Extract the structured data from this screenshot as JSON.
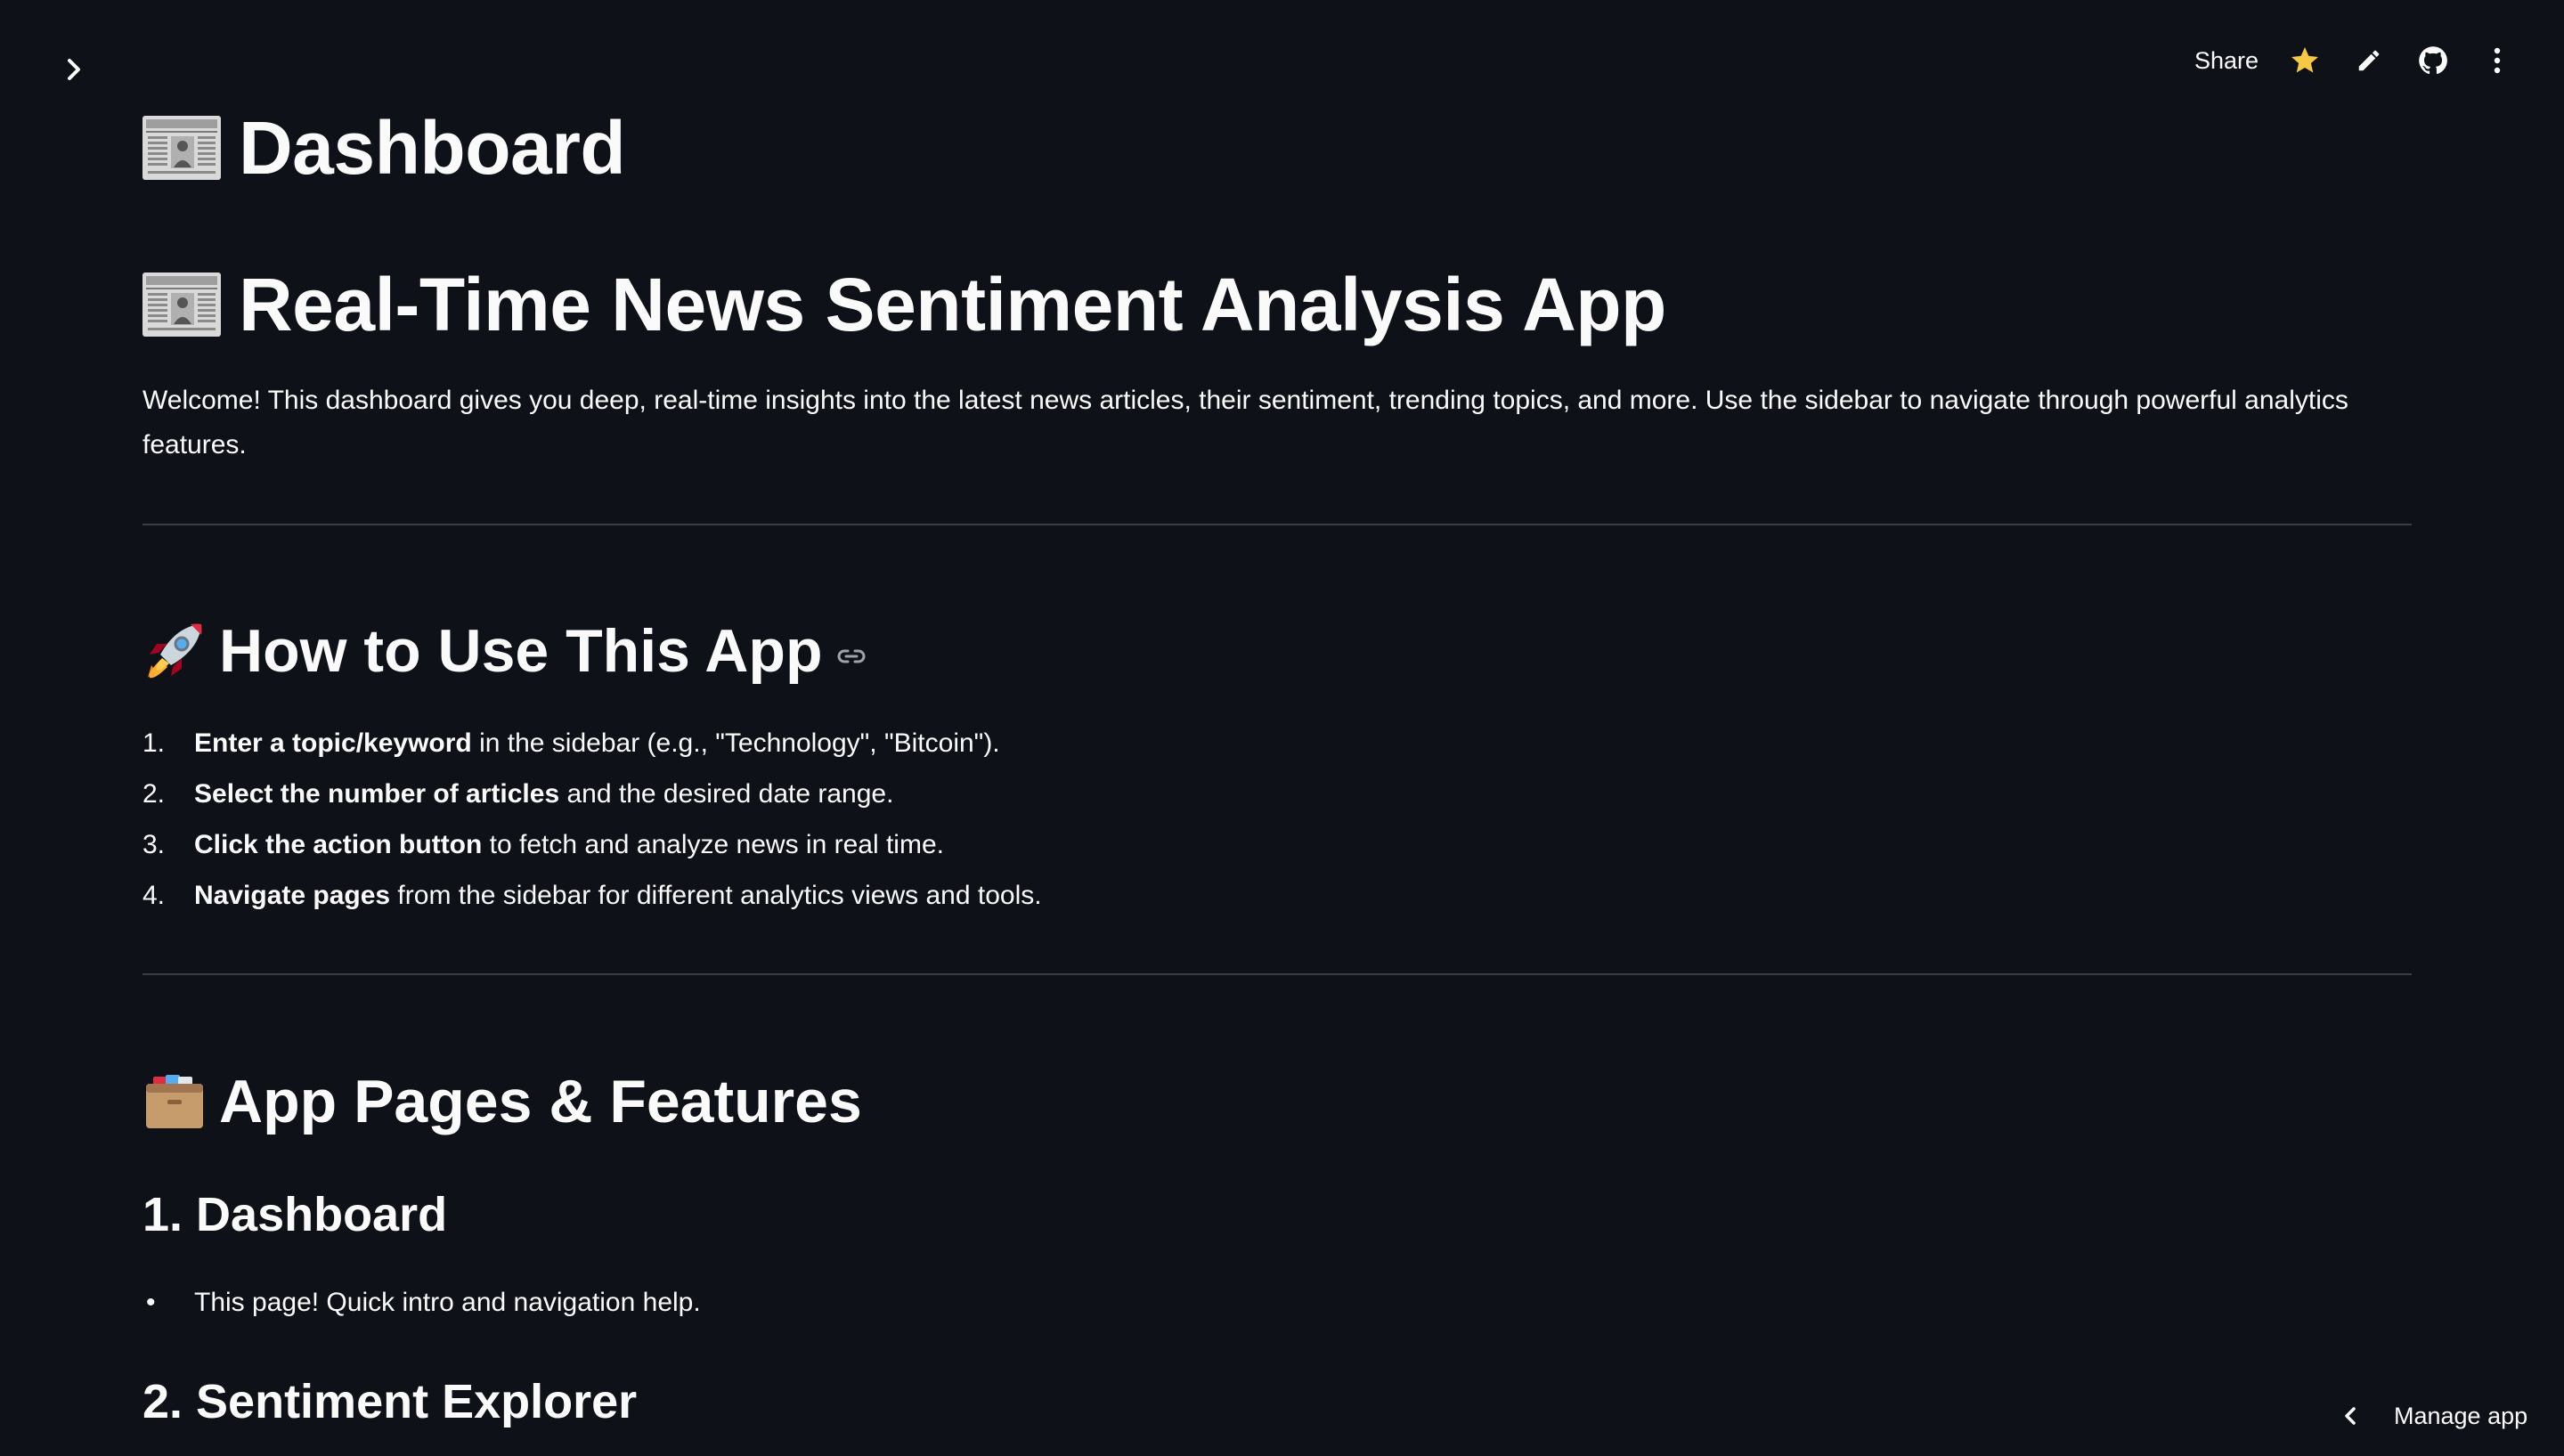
{
  "header": {
    "share_label": "Share"
  },
  "icons": {
    "sidebar_toggle": "chevron-right-icon",
    "favorite": "star-icon",
    "edit": "pencil-icon",
    "source": "github-icon",
    "menu": "kebab-menu-icon",
    "newspaper": "newspaper-icon",
    "rocket": "rocket-icon",
    "card_box": "card-file-box-icon",
    "anchor_link": "link-icon"
  },
  "colors": {
    "background": "#0e1117",
    "text": "#fafafa",
    "star": "#f7c844",
    "divider": "#3a3d45"
  },
  "page": {
    "title": "Dashboard",
    "app_title": "Real-Time News Sentiment Analysis App",
    "intro_line1": "Welcome! This dashboard gives you deep, real-time insights into the latest news articles, their sentiment, trending topics, and more. Use the sidebar to navigate through powerful analytics",
    "intro_line2": "features."
  },
  "how_to": {
    "heading": "How to Use This App",
    "steps": [
      {
        "num": "1.",
        "bold": "Enter a topic/keyword",
        "rest": " in the sidebar (e.g., \"Technology\", \"Bitcoin\")."
      },
      {
        "num": "2.",
        "bold": "Select the number of articles",
        "rest": " and the desired date range."
      },
      {
        "num": "3.",
        "bold": "Click the action button",
        "rest": " to fetch and analyze news in real time."
      },
      {
        "num": "4.",
        "bold": "Navigate pages",
        "rest": " from the sidebar for different analytics views and tools."
      }
    ]
  },
  "features": {
    "heading": "App Pages & Features",
    "sections": [
      {
        "title": "1. Dashboard",
        "bullets": [
          "This page! Quick intro and navigation help."
        ]
      },
      {
        "title": "2. Sentiment Explorer"
      }
    ]
  },
  "footer": {
    "manage_app_label": "Manage app"
  }
}
